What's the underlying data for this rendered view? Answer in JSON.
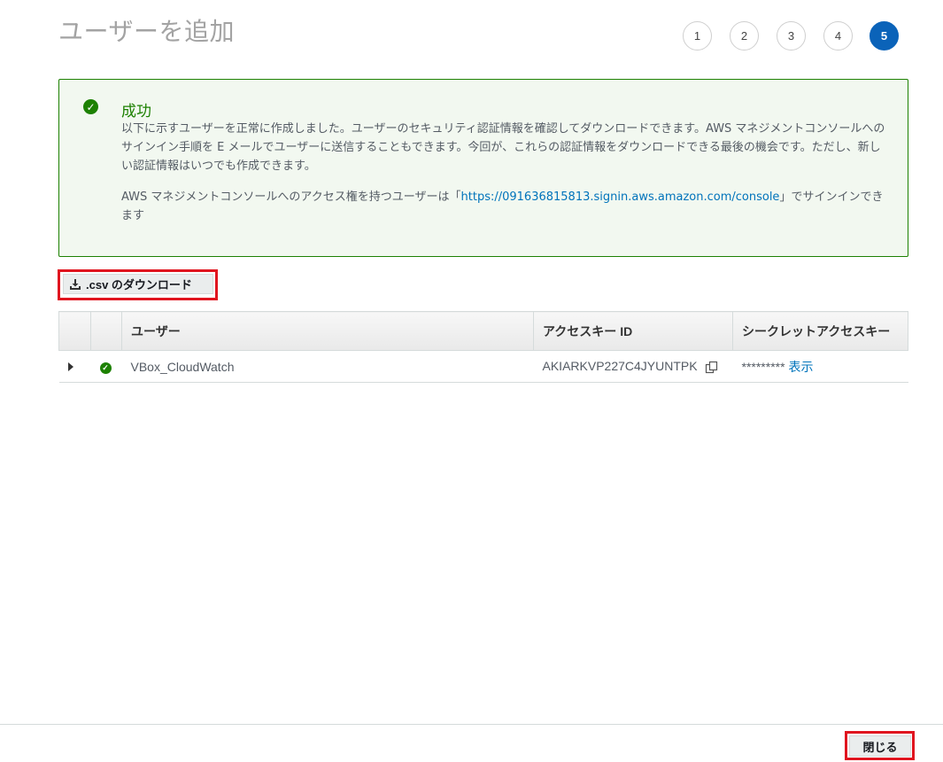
{
  "page": {
    "title": "ユーザーを追加"
  },
  "steps": [
    "1",
    "2",
    "3",
    "4",
    "5"
  ],
  "active_step": "5",
  "alert": {
    "title": "成功",
    "body1": "以下に示すユーザーを正常に作成しました。ユーザーのセキュリティ認証情報を確認してダウンロードできます。AWS マネジメントコンソールへのサインイン手順を E メールでユーザーに送信することもできます。今回が、これらの認証情報をダウンロードできる最後の機会です。ただし、新しい認証情報はいつでも作成できます。",
    "body2_prefix": "AWS マネジメントコンソールへのアクセス権を持つユーザーは「",
    "console_url": "https://091636815813.signin.aws.amazon.com/console",
    "body2_suffix": "」でサインインできます"
  },
  "toolbar": {
    "csv_label": ".csv のダウンロード"
  },
  "table": {
    "headers": {
      "user": "ユーザー",
      "access_key": "アクセスキー ID",
      "secret_key": "シークレットアクセスキー"
    },
    "rows": [
      {
        "user": "VBox_CloudWatch",
        "access_key_id": "AKIARKVP227C4JYUNTPK",
        "secret_masked": "*********",
        "show_label": "表示"
      }
    ]
  },
  "footer": {
    "close_label": "閉じる"
  },
  "colors": {
    "success": "#1d8102",
    "link": "#0073bb",
    "active_step": "#0b63b9",
    "highlight": "#e0151f"
  },
  "icons": [
    "success-check-icon",
    "download-icon",
    "expand-caret-icon",
    "copy-icon"
  ]
}
